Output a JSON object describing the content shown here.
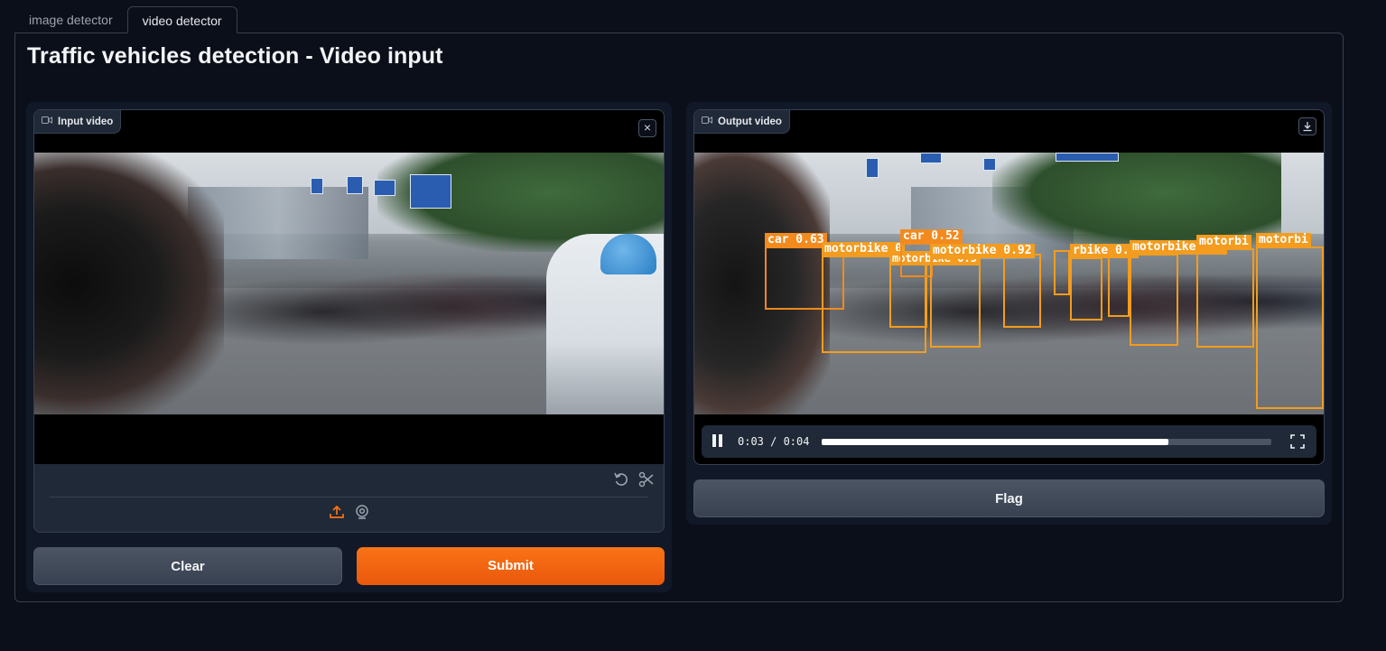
{
  "tabs": [
    {
      "label": "image detector",
      "active": false
    },
    {
      "label": "video detector",
      "active": true
    }
  ],
  "page_title": "Traffic vehicles detection - Video input",
  "input_video": {
    "label": "Input video",
    "icon": "video-camera-icon",
    "close_icon": "close-icon",
    "edit_icons": [
      "undo-icon",
      "scissors-icon"
    ],
    "source_icons": [
      "upload-icon",
      "webcam-icon"
    ]
  },
  "output_video": {
    "label": "Output video",
    "icon": "video-camera-icon",
    "download_icon": "download-icon",
    "time_display": "0:03 / 0:04",
    "progress_fraction": 0.77,
    "detections": [
      {
        "label": "car 0.63",
        "class": "car"
      },
      {
        "label": "motorbike 0",
        "class": "motorbike"
      },
      {
        "label": "motorbike 0.5",
        "class": "motorbike"
      },
      {
        "label": "car 0.52",
        "class": "car"
      },
      {
        "label": "motorbike 0.92",
        "class": "motorbike"
      },
      {
        "label": "rbike 0.8",
        "class": "motorbike"
      },
      {
        "label": "motorbike 0.7",
        "class": "motorbike"
      },
      {
        "label": "motorbi",
        "class": "motorbike"
      },
      {
        "label": "motorbi",
        "class": "motorbike"
      }
    ]
  },
  "buttons": {
    "clear": "Clear",
    "submit": "Submit",
    "flag": "Flag"
  },
  "colors": {
    "background": "#0b0f19",
    "primary": "#f97316",
    "detection_box": "#f39c1f"
  }
}
